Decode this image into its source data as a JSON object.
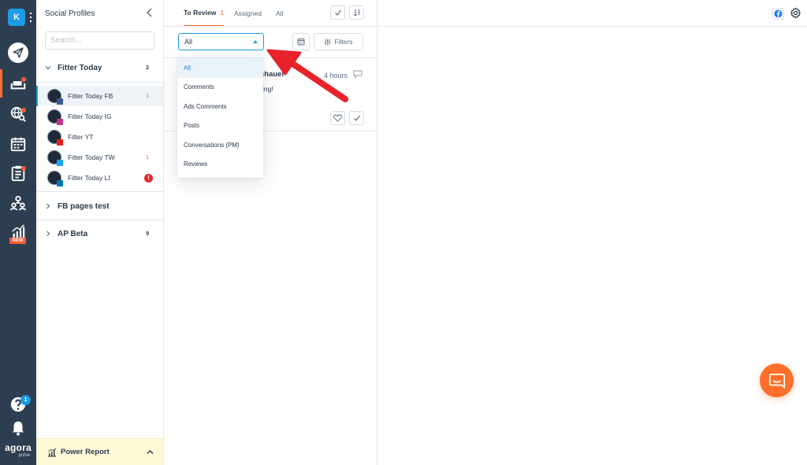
{
  "rail": {
    "account_initial": "K",
    "new_badge": "NEW",
    "help_badge": "1",
    "brand_name": "agora",
    "brand_sub": "pulse"
  },
  "profiles": {
    "title": "Social Profiles",
    "search_placeholder": "Search...",
    "groups": [
      {
        "name": "Fitter Today",
        "count": "2",
        "items": [
          {
            "name": "Fitter Today FB",
            "count": "1",
            "network": "facebook"
          },
          {
            "name": "Fitter Today IG",
            "count": "",
            "network": "instagram"
          },
          {
            "name": "Fitter YT",
            "count": "",
            "network": "youtube"
          },
          {
            "name": "Fitter Today TW",
            "count": "1",
            "network": "twitter"
          },
          {
            "name": "Fitter Today LI",
            "count": "!",
            "network": "linkedin"
          }
        ]
      },
      {
        "name": "FB pages test",
        "count": ""
      },
      {
        "name": "AP Beta",
        "count": "9"
      }
    ],
    "power_report": "Power Report"
  },
  "inbox": {
    "tabs": {
      "review_label": "To Review",
      "review_count": "1",
      "assigned_label": "Assigned",
      "all_label": "All"
    },
    "filter_select_value": "All",
    "filters_label": "Filters",
    "item": {
      "author_visible": "shauer",
      "time": "4 hours",
      "text_visible": "ing!"
    },
    "dropdown_options": [
      "All",
      "Comments",
      "Ads Comments",
      "Posts",
      "Conversations (PM)",
      "Reviews"
    ]
  },
  "colors": {
    "rail_bg": "#2d3e50",
    "accent_orange": "#ff6e2a",
    "accent_blue": "#1c9be6",
    "alert_red": "#e3262d",
    "arrow_red": "#e8232a",
    "power_report_bg": "#fef9d7"
  }
}
